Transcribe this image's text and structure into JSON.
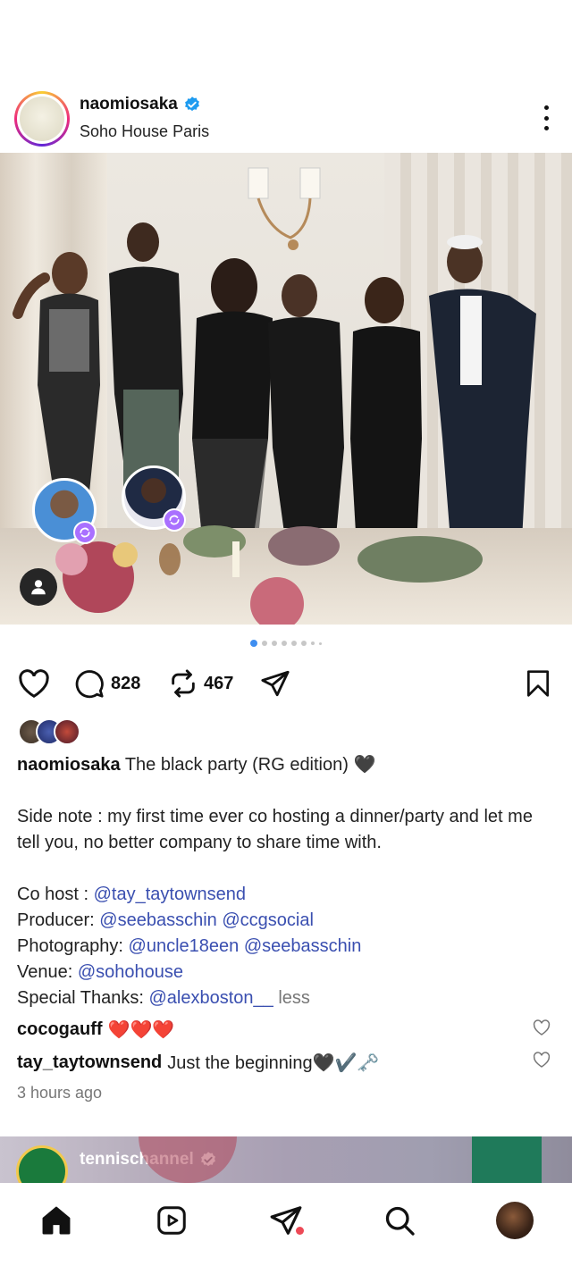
{
  "post": {
    "username": "naomiosaka",
    "location": "Soho House Paris",
    "comment_count": "828",
    "repost_count": "467",
    "caption": {
      "username": "naomiosaka",
      "title": "The black party (RG edition) 🖤",
      "side_note": "Side note : my first time ever co hosting a dinner/party and let me tell you, no better company to share time with.",
      "co_host_label": "Co host :",
      "co_host": "@tay_taytownsend",
      "producer_label": "Producer:",
      "producer_1": "@seebasschin",
      "producer_2": "@ccgsocial",
      "photography_label": "Photography:",
      "photography_1": "@uncle18een",
      "photography_2": "@seebasschin",
      "venue_label": "Venue:",
      "venue": "@sohohouse",
      "thanks_label": "Special Thanks:",
      "thanks": "@alexboston__",
      "less": "less"
    },
    "comments": [
      {
        "user": "cocogauff",
        "text": "❤️❤️❤️"
      },
      {
        "user": "tay_taytownsend",
        "text": "Just the beginning🖤✔️🗝️"
      }
    ],
    "timestamp": "3 hours ago",
    "carousel": {
      "total": 8,
      "active": 0
    }
  },
  "next_post": {
    "username": "tennischannel"
  },
  "colors": {
    "accent": "#3897f0",
    "mention": "#3a4fb0",
    "tag_badge": "#a970ff",
    "notification_dot": "#ed4956"
  },
  "icons": {
    "like": "heart-icon",
    "comment": "comment-icon",
    "repost": "repost-icon",
    "share": "send-icon",
    "save": "bookmark-icon",
    "more": "more-icon"
  }
}
